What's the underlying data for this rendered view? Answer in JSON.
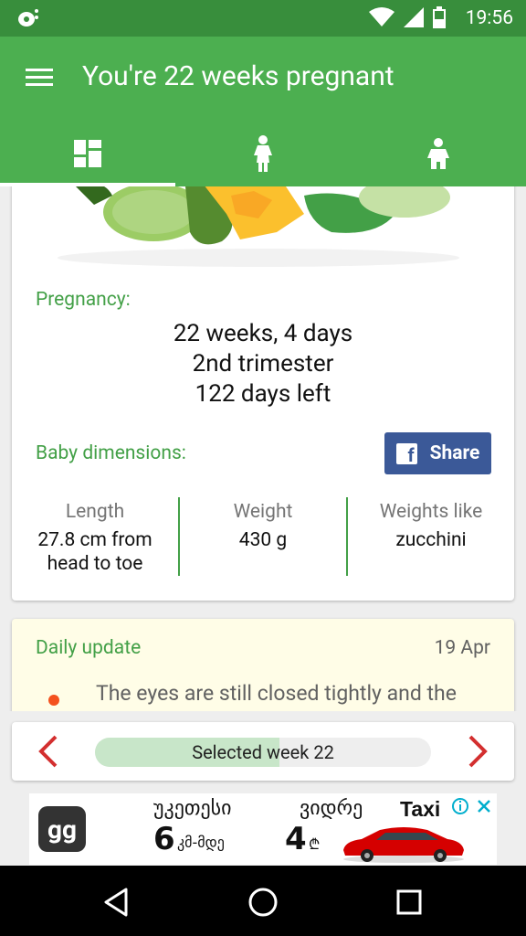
{
  "status_bar": {
    "time": "19:56"
  },
  "app_bar": {
    "title": "You're 22 weeks pregnant"
  },
  "tabs": [
    {
      "icon": "dashboard-icon",
      "active": true
    },
    {
      "icon": "mother-icon",
      "active": false
    },
    {
      "icon": "baby-icon",
      "active": false
    }
  ],
  "pregnancy": {
    "label": "Pregnancy:",
    "weeks": "22 weeks, 4 days",
    "trimester": "2nd trimester",
    "days_left": "122 days left"
  },
  "baby": {
    "label": "Baby dimensions:",
    "share_label": "Share",
    "length_label": "Length",
    "length_value": "27.8 cm from head to toe",
    "weight_label": "Weight",
    "weight_value": "430 g",
    "weighs_like_label": "Weights like",
    "weighs_like_value": "zucchini"
  },
  "daily": {
    "title": "Daily update",
    "date": "19 Apr",
    "text": "The eyes are still closed tightly and the lids will be developing over the coming days"
  },
  "week_selector": {
    "label": "Selected week 22",
    "progress": 0.55
  },
  "ad": {
    "brand": "gg",
    "headline1": "უკეთესი",
    "value1": "6",
    "unit1": "კმ-მდე",
    "headline2": "ვიდრე",
    "value2": "4",
    "unit2": "₾",
    "product": "Taxi"
  },
  "colors": {
    "primary": "#4caf50",
    "primary_dark": "#388e3c",
    "accent_red": "#d32f2f",
    "facebook": "#3b5998"
  }
}
